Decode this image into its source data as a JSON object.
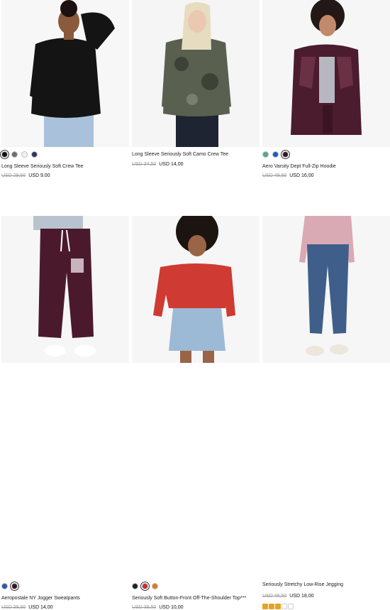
{
  "products": [
    {
      "title": "Long Sleeve Seriously Soft Crew Tee",
      "old_price": "USD 29,50",
      "new_price": "USD 9.00",
      "image": "model-black-long-sleeve-tee",
      "swatches": [
        "#111111",
        "#6b6f7a",
        "#f2f2f2",
        "#2b3566"
      ]
    },
    {
      "title": "Long Sleeve Seriously Soft Camo Crew Tee",
      "old_price": "USD 34,50",
      "new_price": "USD 14,00",
      "image": "model-camo-long-sleeve-tee",
      "swatches": []
    },
    {
      "title": "Aero Varsity Dept Full-Zip Hoodie",
      "old_price": "USD 49,50",
      "new_price": "USD 16,00",
      "image": "model-maroon-zip-hoodie",
      "swatches": [
        "#55a88a",
        "#1c5fc4",
        "#3a1424"
      ]
    },
    {
      "title": "Aeropostale NY Jogger Sweatpants",
      "old_price": "USD 39,50",
      "new_price": "USD 14,00",
      "image": "model-maroon-jogger-sweatpants",
      "swatches": [
        "#2c57b5",
        "#3a1424"
      ]
    },
    {
      "title": "Seriously Soft Button-Front Off-The-Shoulder Top***",
      "old_price": "USD 39,50",
      "new_price": "USD 10,00",
      "image": "model-red-off-shoulder-top",
      "swatches": [
        "#222222",
        "#cc2b2b",
        "#e07a24"
      ]
    },
    {
      "title": "Seriously Stretchy Low-Rise Jegging",
      "old_price": "USD 46,50",
      "new_price": "USD 18,00",
      "image": "model-blue-jeggings",
      "swatches": [],
      "rating": 3,
      "rating_max": 5
    }
  ]
}
